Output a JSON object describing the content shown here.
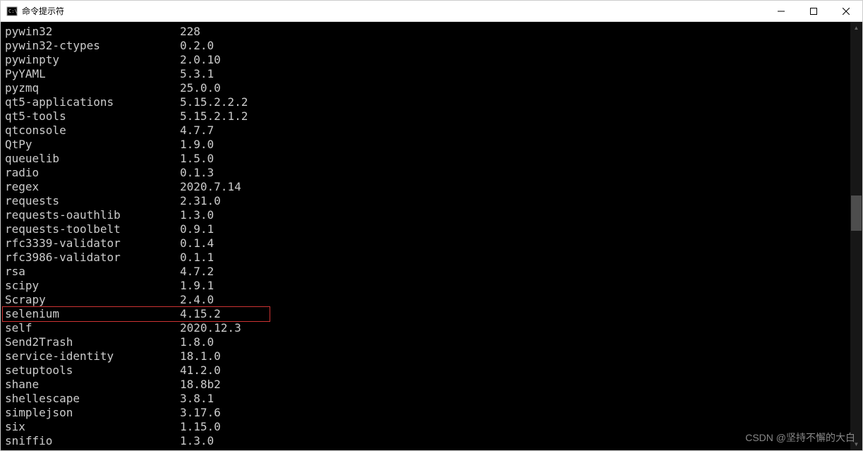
{
  "window": {
    "title": "命令提示符"
  },
  "packages": [
    {
      "name": "pywin32",
      "version": "228",
      "highlighted": false
    },
    {
      "name": "pywin32-ctypes",
      "version": "0.2.0",
      "highlighted": false
    },
    {
      "name": "pywinpty",
      "version": "2.0.10",
      "highlighted": false
    },
    {
      "name": "PyYAML",
      "version": "5.3.1",
      "highlighted": false
    },
    {
      "name": "pyzmq",
      "version": "25.0.0",
      "highlighted": false
    },
    {
      "name": "qt5-applications",
      "version": "5.15.2.2.2",
      "highlighted": false
    },
    {
      "name": "qt5-tools",
      "version": "5.15.2.1.2",
      "highlighted": false
    },
    {
      "name": "qtconsole",
      "version": "4.7.7",
      "highlighted": false
    },
    {
      "name": "QtPy",
      "version": "1.9.0",
      "highlighted": false
    },
    {
      "name": "queuelib",
      "version": "1.5.0",
      "highlighted": false
    },
    {
      "name": "radio",
      "version": "0.1.3",
      "highlighted": false
    },
    {
      "name": "regex",
      "version": "2020.7.14",
      "highlighted": false
    },
    {
      "name": "requests",
      "version": "2.31.0",
      "highlighted": false
    },
    {
      "name": "requests-oauthlib",
      "version": "1.3.0",
      "highlighted": false
    },
    {
      "name": "requests-toolbelt",
      "version": "0.9.1",
      "highlighted": false
    },
    {
      "name": "rfc3339-validator",
      "version": "0.1.4",
      "highlighted": false
    },
    {
      "name": "rfc3986-validator",
      "version": "0.1.1",
      "highlighted": false
    },
    {
      "name": "rsa",
      "version": "4.7.2",
      "highlighted": false
    },
    {
      "name": "scipy",
      "version": "1.9.1",
      "highlighted": false
    },
    {
      "name": "Scrapy",
      "version": "2.4.0",
      "highlighted": false
    },
    {
      "name": "selenium",
      "version": "4.15.2",
      "highlighted": true
    },
    {
      "name": "self",
      "version": "2020.12.3",
      "highlighted": false
    },
    {
      "name": "Send2Trash",
      "version": "1.8.0",
      "highlighted": false
    },
    {
      "name": "service-identity",
      "version": "18.1.0",
      "highlighted": false
    },
    {
      "name": "setuptools",
      "version": "41.2.0",
      "highlighted": false
    },
    {
      "name": "shane",
      "version": "18.8b2",
      "highlighted": false
    },
    {
      "name": "shellescape",
      "version": "3.8.1",
      "highlighted": false
    },
    {
      "name": "simplejson",
      "version": "3.17.6",
      "highlighted": false
    },
    {
      "name": "six",
      "version": "1.15.0",
      "highlighted": false
    },
    {
      "name": "sniffio",
      "version": "1.3.0",
      "highlighted": false
    }
  ],
  "watermark": "CSDN @坚持不懈的大白"
}
